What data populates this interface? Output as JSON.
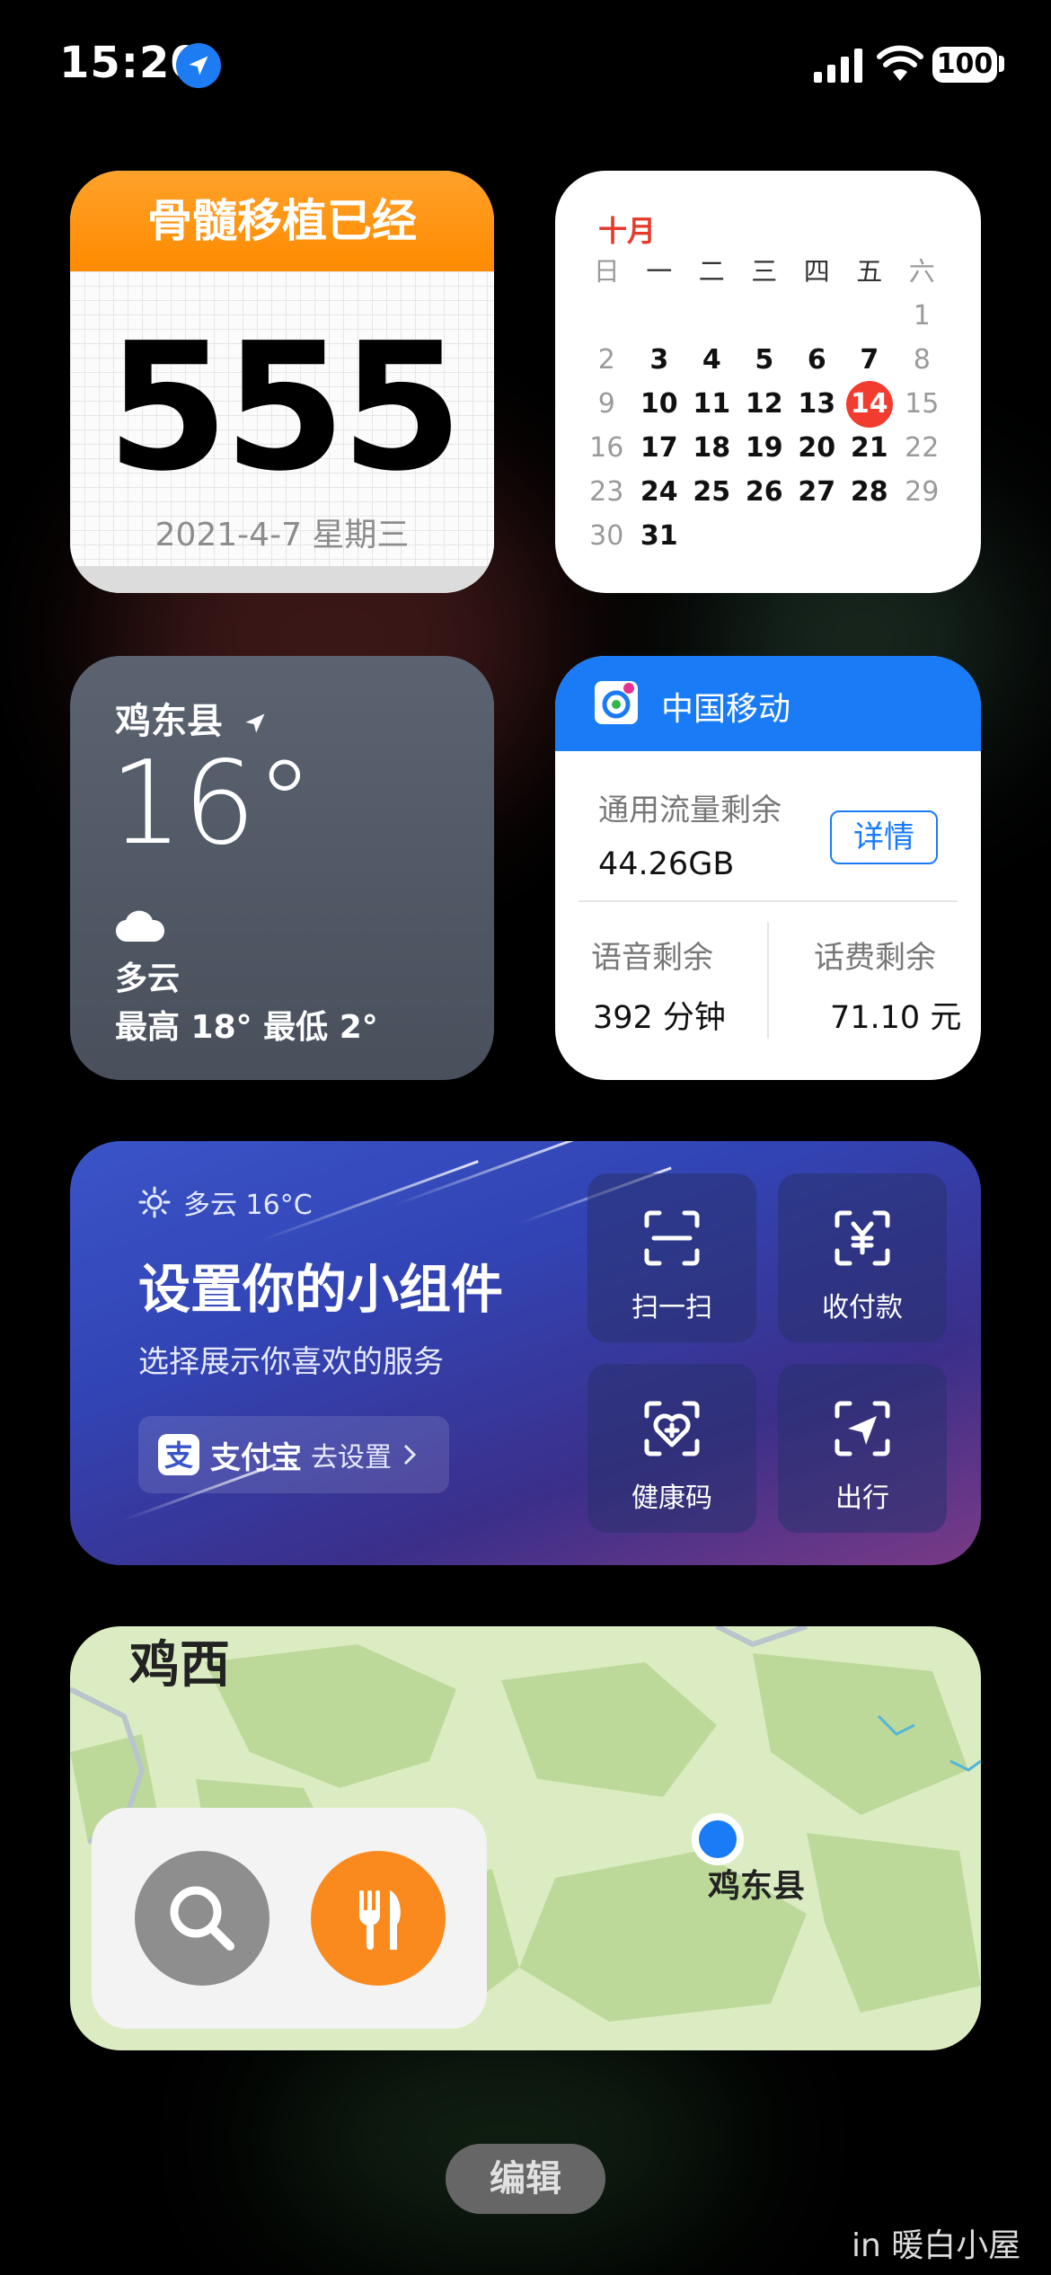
{
  "status_bar": {
    "time": "15:20",
    "battery": "100"
  },
  "countdown": {
    "title": "骨髓移植已经",
    "days": "555",
    "date": "2021-4-7 星期三"
  },
  "calendar": {
    "month": "十月",
    "weekdays": [
      "日",
      "一",
      "二",
      "三",
      "四",
      "五",
      "六"
    ],
    "rows": [
      [
        "",
        "",
        "",
        "",
        "",
        "",
        "1"
      ],
      [
        "2",
        "3",
        "4",
        "5",
        "6",
        "7",
        "8"
      ],
      [
        "9",
        "10",
        "11",
        "12",
        "13",
        "14",
        "15"
      ],
      [
        "16",
        "17",
        "18",
        "19",
        "20",
        "21",
        "22"
      ],
      [
        "23",
        "24",
        "25",
        "26",
        "27",
        "28",
        "29"
      ],
      [
        "30",
        "31",
        "",
        "",
        "",
        "",
        ""
      ]
    ],
    "today": "14"
  },
  "weather": {
    "city": "鸡东县",
    "temp": "16°",
    "condition": "多云",
    "high_low": "最高 18° 最低 2°"
  },
  "mobile": {
    "carrier": "中国移动",
    "data_label": "通用流量剩余",
    "data_value": "44.26GB",
    "detail_button": "详情",
    "voice_label": "语音剩余",
    "voice_value": "392 分钟",
    "fee_label": "话费剩余",
    "fee_value": "71.10 元"
  },
  "alipay": {
    "weather": "多云 16°C",
    "title": "设置你的小组件",
    "subtitle": "选择展示你喜欢的服务",
    "brand": "支付宝",
    "setup": "去设置",
    "tiles": [
      {
        "label": "扫一扫",
        "icon": "scan-icon"
      },
      {
        "label": "收付款",
        "icon": "payment-icon"
      },
      {
        "label": "健康码",
        "icon": "health-code-icon"
      },
      {
        "label": "出行",
        "icon": "travel-icon"
      }
    ]
  },
  "map": {
    "region": "鸡西",
    "pin_label": "鸡东县",
    "search_icon": "search-icon",
    "food_icon": "fork-knife-icon"
  },
  "footer": {
    "edit": "编辑",
    "credit": "in 暖白小屋"
  }
}
